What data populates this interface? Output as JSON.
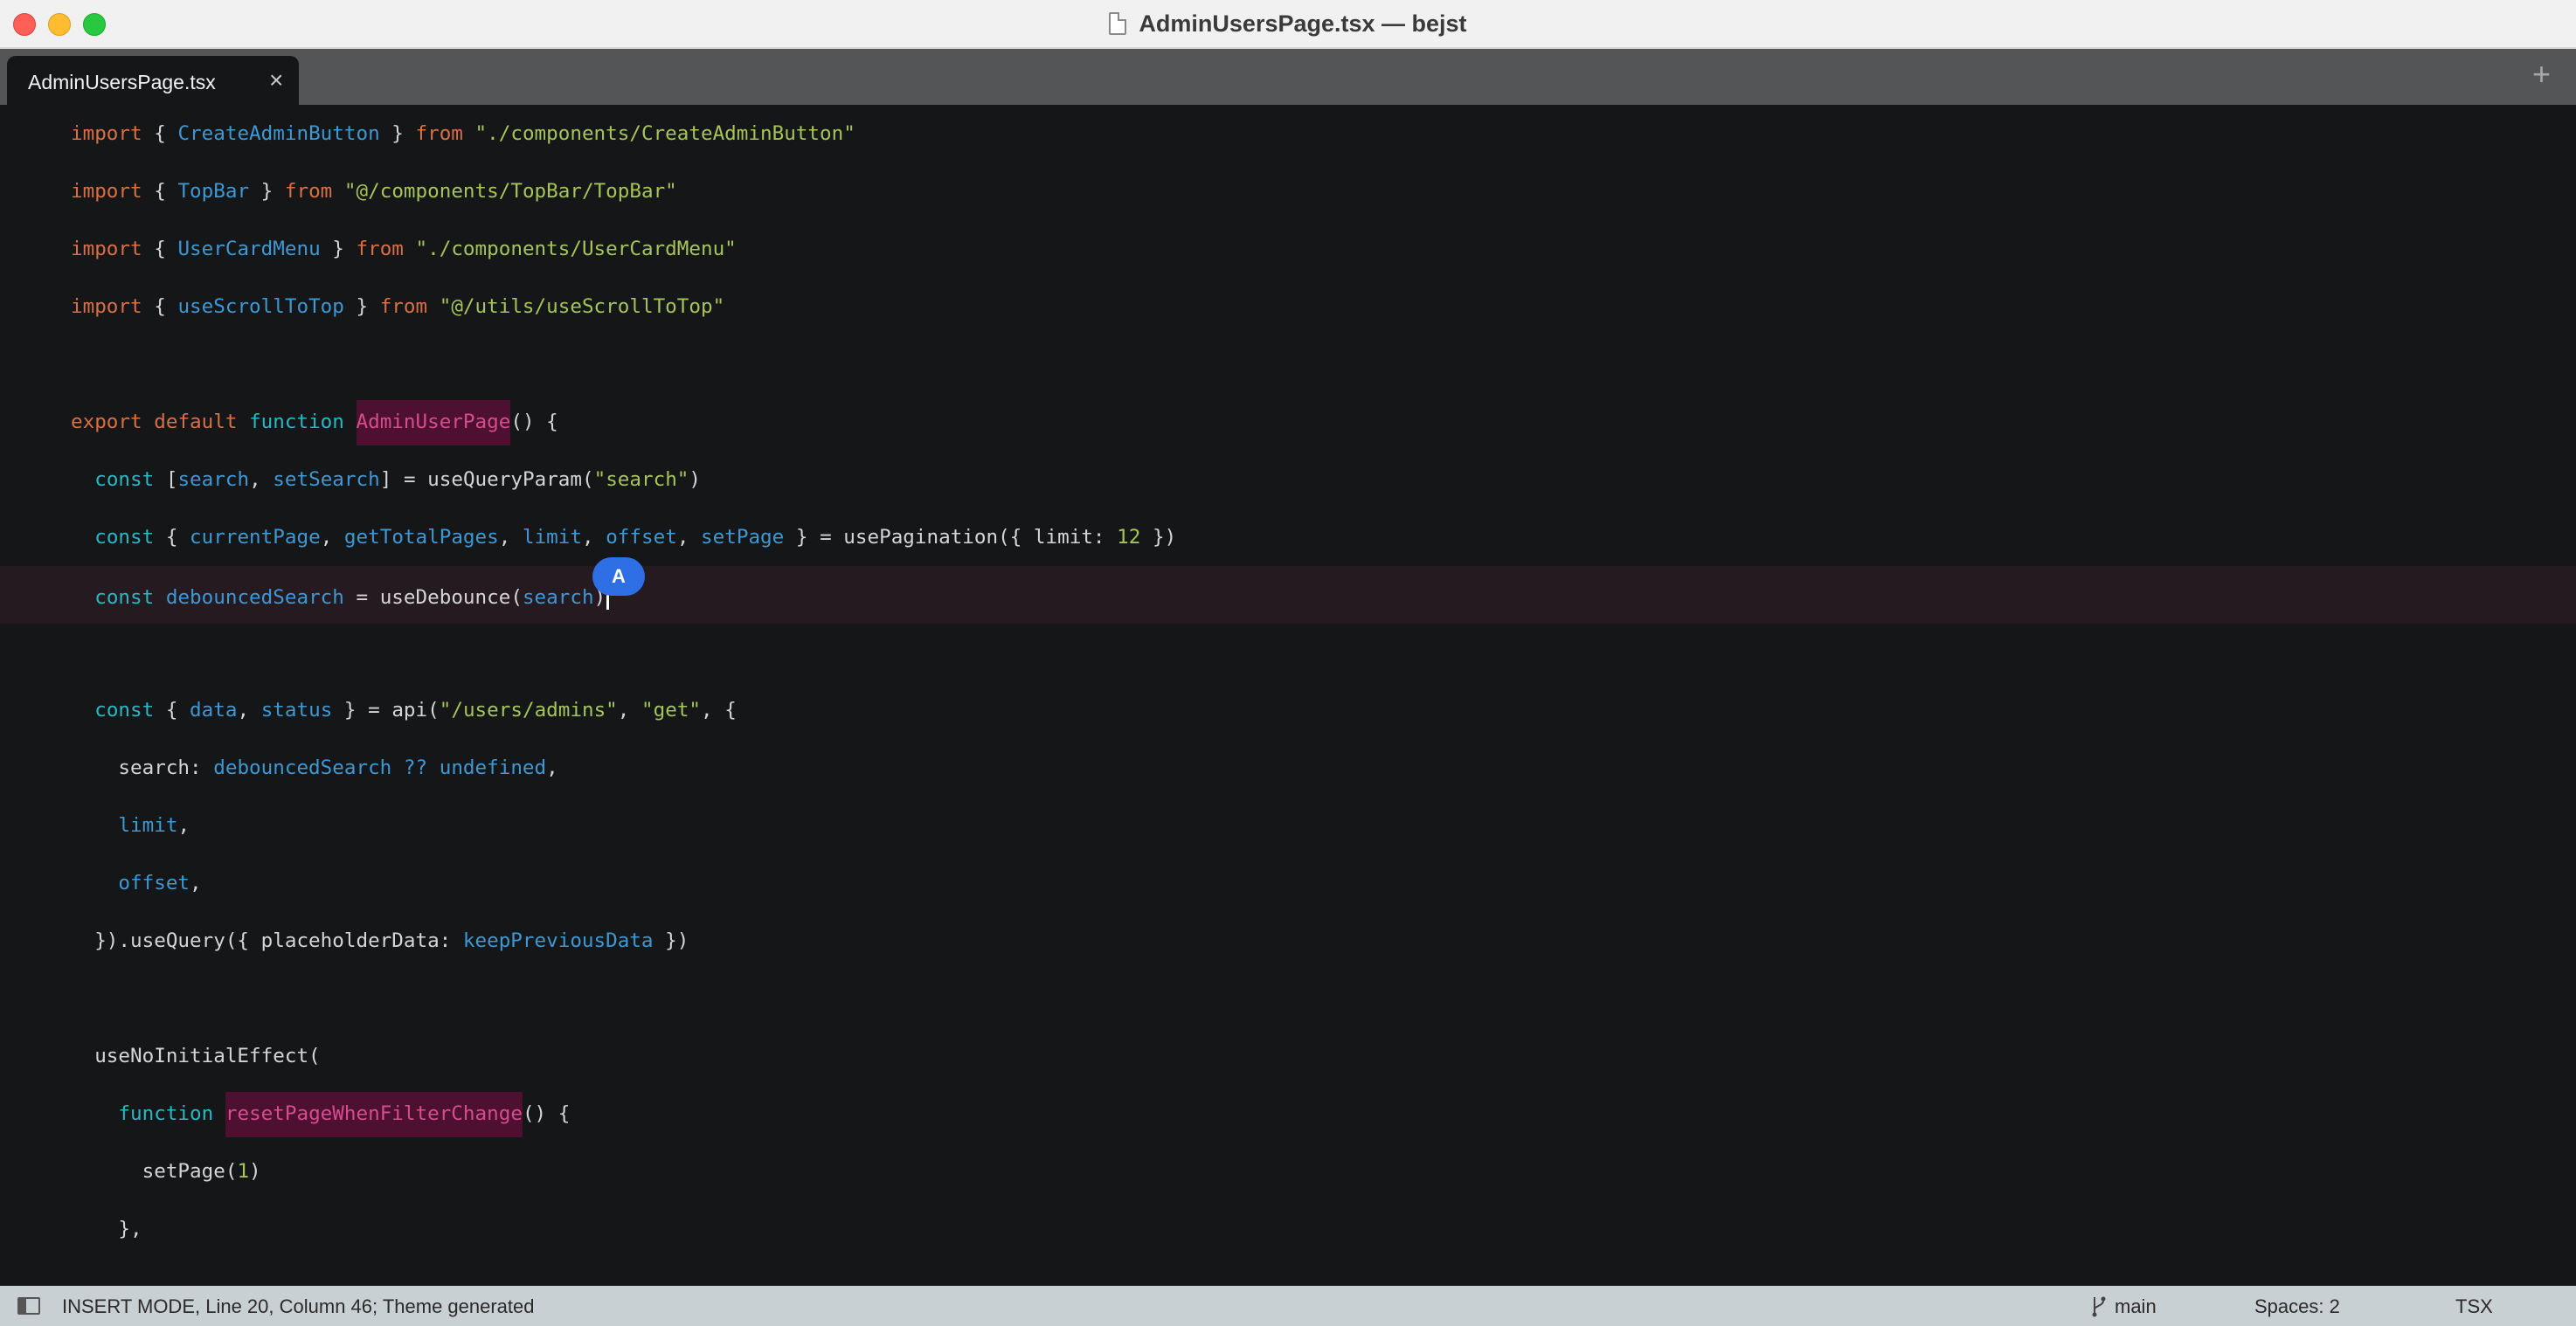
{
  "window": {
    "title": "AdminUsersPage.tsx — bejst"
  },
  "tabs": [
    {
      "label": "AdminUsersPage.tsx",
      "close": "×",
      "active": true
    }
  ],
  "tab_add": "+",
  "editor": {
    "lines": [
      [
        [
          "kw",
          "import"
        ],
        [
          "p",
          " { "
        ],
        [
          "id",
          "CreateAdminButton"
        ],
        [
          "p",
          " } "
        ],
        [
          "kw",
          "from"
        ],
        [
          "p",
          " "
        ],
        [
          "str",
          "\"./components/CreateAdminButton\""
        ]
      ],
      [
        [
          "kw",
          "import"
        ],
        [
          "p",
          " { "
        ],
        [
          "id",
          "TopBar"
        ],
        [
          "p",
          " } "
        ],
        [
          "kw",
          "from"
        ],
        [
          "p",
          " "
        ],
        [
          "str",
          "\"@/components/TopBar/TopBar\""
        ]
      ],
      [
        [
          "kw",
          "import"
        ],
        [
          "p",
          " { "
        ],
        [
          "id",
          "UserCardMenu"
        ],
        [
          "p",
          " } "
        ],
        [
          "kw",
          "from"
        ],
        [
          "p",
          " "
        ],
        [
          "str",
          "\"./components/UserCardMenu\""
        ]
      ],
      [
        [
          "kw",
          "import"
        ],
        [
          "p",
          " { "
        ],
        [
          "id",
          "useScrollToTop"
        ],
        [
          "p",
          " } "
        ],
        [
          "kw",
          "from"
        ],
        [
          "p",
          " "
        ],
        [
          "str",
          "\"@/utils/useScrollToTop\""
        ]
      ],
      [],
      [
        [
          "kw",
          "export"
        ],
        [
          "p",
          " "
        ],
        [
          "kw",
          "default"
        ],
        [
          "p",
          " "
        ],
        [
          "fn",
          "function"
        ],
        [
          "p",
          " "
        ],
        [
          "hl",
          "AdminUserPage"
        ],
        [
          "p",
          "() {"
        ]
      ],
      [
        [
          "p",
          "  "
        ],
        [
          "fn",
          "const"
        ],
        [
          "p",
          " ["
        ],
        [
          "id",
          "search"
        ],
        [
          "p",
          ", "
        ],
        [
          "id",
          "setSearch"
        ],
        [
          "p",
          "] = useQueryParam("
        ],
        [
          "str",
          "\"search\""
        ],
        [
          "p",
          ")"
        ]
      ],
      [
        [
          "p",
          "  "
        ],
        [
          "fn",
          "const"
        ],
        [
          "p",
          " { "
        ],
        [
          "id",
          "currentPage"
        ],
        [
          "p",
          ", "
        ],
        [
          "id",
          "getTotalPages"
        ],
        [
          "p",
          ", "
        ],
        [
          "id",
          "limit"
        ],
        [
          "p",
          ", "
        ],
        [
          "id",
          "offset"
        ],
        [
          "p",
          ", "
        ],
        [
          "id",
          "setPage"
        ],
        [
          "p",
          " } = usePagination({ limit: "
        ],
        [
          "num",
          "12"
        ],
        [
          "p",
          " })"
        ]
      ],
      [
        [
          "p",
          "  "
        ],
        [
          "fn",
          "const"
        ],
        [
          "p",
          " "
        ],
        [
          "id",
          "debouncedSearch"
        ],
        [
          "p",
          " = useDebounce("
        ],
        [
          "id",
          "search"
        ],
        [
          "p",
          ")"
        ],
        [
          "cursor",
          ""
        ]
      ],
      [],
      [
        [
          "p",
          "  "
        ],
        [
          "fn",
          "const"
        ],
        [
          "p",
          " { "
        ],
        [
          "id",
          "data"
        ],
        [
          "p",
          ", "
        ],
        [
          "id",
          "status"
        ],
        [
          "p",
          " } = api("
        ],
        [
          "str",
          "\"/users/admins\""
        ],
        [
          "p",
          ", "
        ],
        [
          "str",
          "\"get\""
        ],
        [
          "p",
          ", {"
        ]
      ],
      [
        [
          "p",
          "    search: "
        ],
        [
          "id",
          "debouncedSearch"
        ],
        [
          "p",
          " "
        ],
        [
          "id",
          "??"
        ],
        [
          "p",
          " "
        ],
        [
          "id",
          "undefined"
        ],
        [
          "p",
          ","
        ]
      ],
      [
        [
          "p",
          "    "
        ],
        [
          "id",
          "limit"
        ],
        [
          "p",
          ","
        ]
      ],
      [
        [
          "p",
          "    "
        ],
        [
          "id",
          "offset"
        ],
        [
          "p",
          ","
        ]
      ],
      [
        [
          "p",
          "  }).useQuery({ placeholderData: "
        ],
        [
          "id",
          "keepPreviousData"
        ],
        [
          "p",
          " })"
        ]
      ],
      [],
      [
        [
          "p",
          "  useNoInitialEffect("
        ]
      ],
      [
        [
          "p",
          "    "
        ],
        [
          "fn",
          "function"
        ],
        [
          "p",
          " "
        ],
        [
          "hl",
          "resetPageWhenFilterChange"
        ],
        [
          "p",
          "() {"
        ]
      ],
      [
        [
          "p",
          "      setPage("
        ],
        [
          "num",
          "1"
        ],
        [
          "p",
          ")"
        ]
      ],
      [
        [
          "p",
          "    },"
        ]
      ]
    ],
    "active_line_index": 8,
    "overlay_badge": "A"
  },
  "status_bar": {
    "mode": "INSERT MODE, Line 20, Column 46; Theme generated",
    "branch": "main",
    "indent": "Spaces: 2",
    "syntax": "TSX"
  },
  "colors": {
    "keyword": "#d86f45",
    "function_keyword": "#2ab7c4",
    "identifier": "#3d98d4",
    "string": "#a7c45a",
    "highlight_bg": "#4d1030",
    "highlight_fg": "#d64c8f",
    "badge": "#2f6fe5"
  }
}
